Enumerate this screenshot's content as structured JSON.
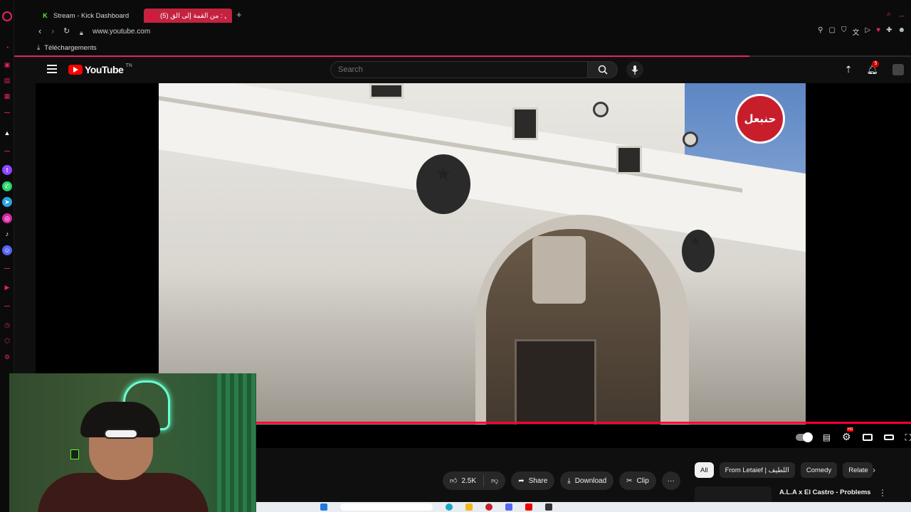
{
  "browser": {
    "tabs": [
      {
        "label": "Stream - Kick Dashboard",
        "icon": "kick-icon",
        "active": false
      },
      {
        "label": "(5) حنبعل : من القمة إلى الق",
        "icon": "youtube-icon",
        "active": true
      }
    ],
    "url": "www.youtube.com",
    "bookmarks": [
      {
        "label": "Téléchargements",
        "icon": "download-icon"
      }
    ]
  },
  "youtube": {
    "logo_text": "YouTube",
    "region": "TN",
    "search": {
      "placeholder": "Search",
      "value": ""
    },
    "notifications_count": "5"
  },
  "video": {
    "channel_badge_text": "حنبعل",
    "progress": 1.0
  },
  "actions": {
    "likes": "2.5K",
    "share": "Share",
    "download": "Download",
    "clip": "Clip",
    "more": "···"
  },
  "chips": [
    "All",
    "From Letaief | اللطيف",
    "Comedy",
    "Relate"
  ],
  "recommendation": {
    "title": "A.L.A x El Castro - Problems"
  },
  "colors": {
    "accent": "#c4233f",
    "youtube_red": "#ff0000",
    "kick_green": "#53fc18"
  }
}
